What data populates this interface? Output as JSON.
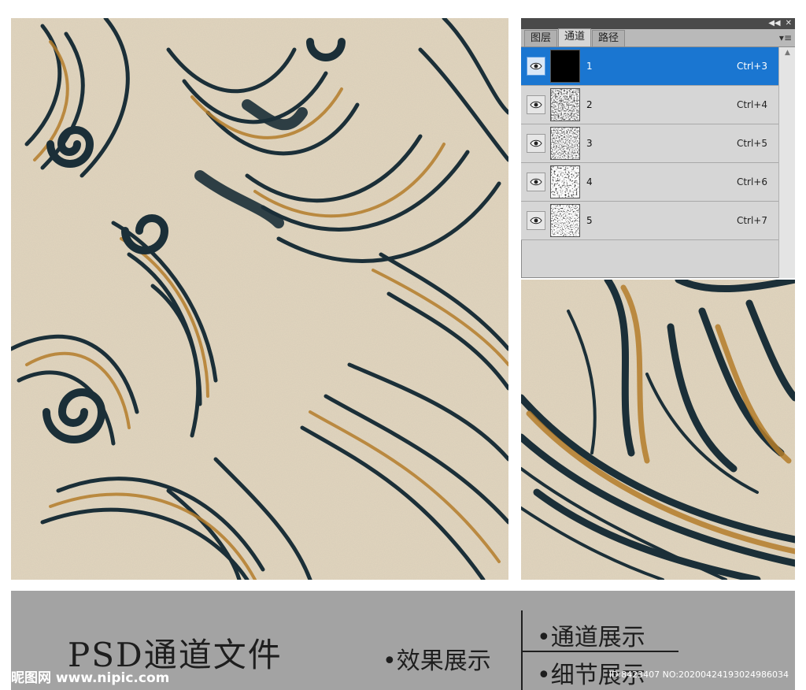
{
  "panel": {
    "tabs": [
      {
        "label": "图层"
      },
      {
        "label": "通道"
      },
      {
        "label": "路径"
      }
    ],
    "collapse_icon": "double-chevron-icon",
    "close_icon": "close-icon",
    "menu_icon": "panel-menu-icon",
    "channels": [
      {
        "name": "1",
        "shortcut": "Ctrl+3",
        "selected": true
      },
      {
        "name": "2",
        "shortcut": "Ctrl+4"
      },
      {
        "name": "3",
        "shortcut": "Ctrl+5"
      },
      {
        "name": "4",
        "shortcut": "Ctrl+6"
      },
      {
        "name": "5",
        "shortcut": "Ctrl+7"
      }
    ]
  },
  "banner": {
    "title": "PSD通道文件",
    "effect_label": "•效果展示",
    "channel_label": "•通道展示",
    "detail_label": "•细节展示"
  },
  "watermark": {
    "site": "昵图网 www.nipic.com",
    "image_id": "ID:8423407 NO:20200424193024986034"
  },
  "colors": {
    "background": "#e2d5bd",
    "ink": "#1b2f38",
    "ochre": "#b47d2a",
    "selection": "#1a76d1",
    "banner": "#a3a3a3"
  }
}
